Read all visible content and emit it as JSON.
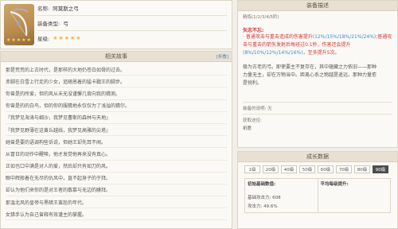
{
  "info": {
    "name_label": "名称:",
    "name_value": "阿莫斯之弓",
    "type_label": "装备类型:",
    "type_value": "弓",
    "rarity_label": "星级:",
    "rarity_stars": "★★★★★",
    "portrait_stars": "★★★★★"
  },
  "story": {
    "title": "相关故事",
    "toggle_label": "[折叠]",
    "lines": [
      "那是荒荒的上古时代，是那样的大地仍苍白如骨的过去。",
      "赤脚在白雪上行走的少女，追随恩着的猛卡戳王的脚步。",
      "你曾是的所爱，但的风从未无没谨懈几背向我的猜测。",
      "你曾是的的白鸟，但的你的服猜地永仅仅为了浅溢的猜尔。",
      "『我梦见海涛与细沙，我梦见曹斯的森林与天地』",
      "『我梦见野薄在这黄丘越线，我梦见高雅的尖塔』",
      "她曾是要的语调构些诉说，但她王却先耳不闻。",
      "从冒日的动作中醒唤，他才发觉他再来没有真心。",
      "正如也口中满是对人的爱，然后却只有如刀的风。",
      "眼中辉般着在无尽的仇风中，直不起身子的于拜。",
      "却认为他们来你的是对王者的散慕与无边的膜拜。",
      "那温北风的皇帝与黑暗王蛮尬的年代。",
      "女猎手认为自己曾释有效谨主的掌握。"
    ]
  },
  "description": {
    "title": "装备描述",
    "refine_note": "精炼(1/2/3/4/5阶)",
    "effect_title": "矢志不忘:",
    "effect_line1_prefix": "· 普通攻击与重击造成的伤害提升",
    "effect_line1_values": "(12%/15%/18%/21%/24%)",
    "effect_line1_suffix": ";普通攻击与重击的箭矢发射后每经过0.1秒，伤害还会提升",
    "effect_line2_values": "(8%/10%/12%/14%/16%)",
    "effect_line2_suffix": "，至多提升5次。",
    "text_lines": [
      "极为古老的弓。即使要主不复存在，其中蕴藏之力依旧——那种",
      "力量无主，却在万物当中。距离心系之物越是遥远，那种力量愈",
      "是锐利。"
    ],
    "flavor_label": "装备的说明:",
    "flavor_value": "无",
    "source_label": "获取途径:",
    "source_value": "祈愿"
  },
  "stats": {
    "title": "成长数据",
    "levels": [
      "1级",
      "20级",
      "40级",
      "50级",
      "60级",
      "70级",
      "80级",
      "90级"
    ],
    "active_level": "90级",
    "base_header": "初始基础数值:",
    "avg_header": "平均每级提升:",
    "base_attack": "基础攻击力: 608",
    "attack_pct": "攻击力: 49.6%"
  }
}
